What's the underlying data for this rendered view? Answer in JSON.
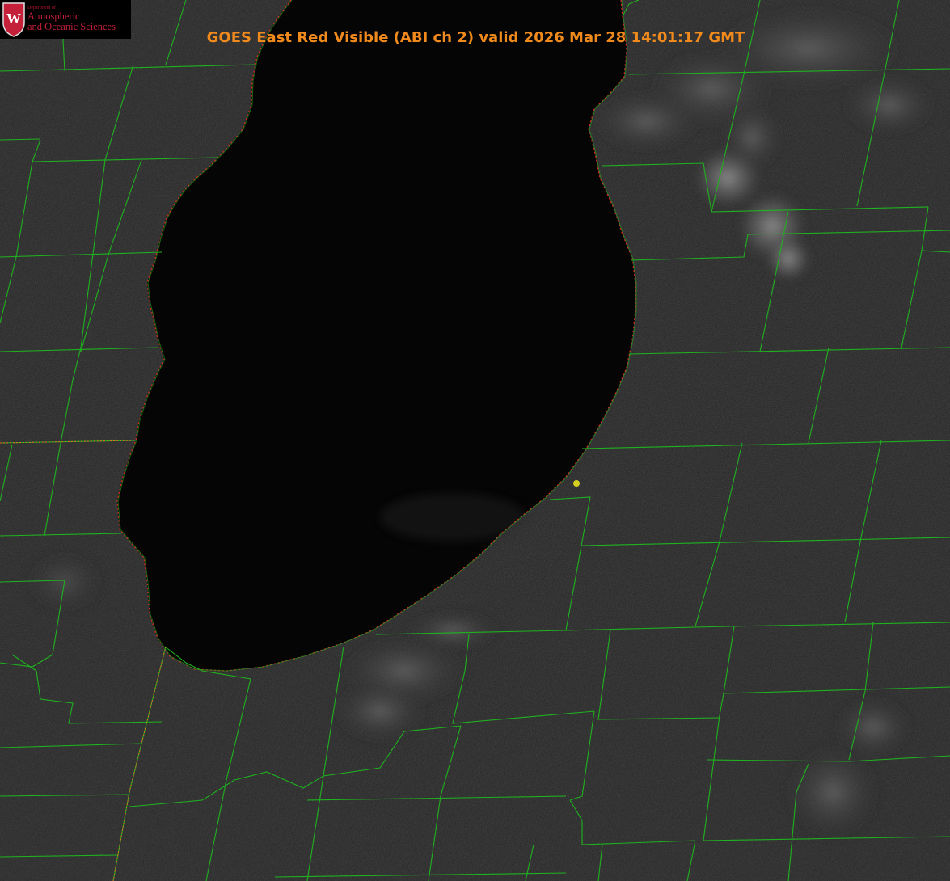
{
  "title": "GOES East Red Visible (ABI ch 2) valid 2026 Mar 28 14:01:17 GMT",
  "logo": {
    "department": "Department of",
    "line1": "Atmospheric",
    "line2": "and Oceanic Sciences",
    "shield_letter": "W"
  },
  "colors": {
    "title": "#f08a1c",
    "county_lines": "#1fb21f",
    "lake_outline": "#e02020",
    "station_marker": "#d6d020",
    "lake": "#050505",
    "land": "#232323",
    "logo_red": "#c5203a"
  },
  "map": {
    "feature": "lake-michigan-southern-basin",
    "station_marker_icon": "yellow-dot-icon",
    "cloud_features": [
      "northeast-cloud-band",
      "southeast-lake-effect-clouds"
    ]
  }
}
